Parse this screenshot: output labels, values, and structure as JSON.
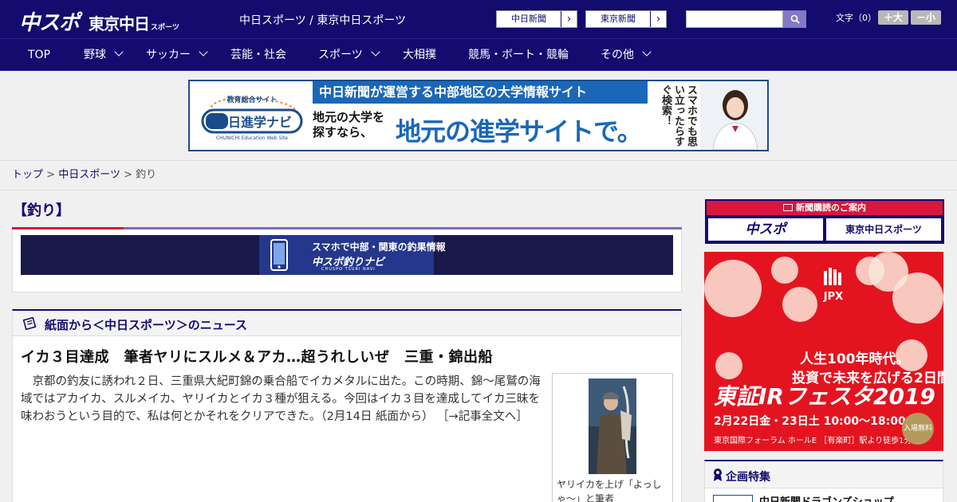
{
  "header": {
    "logo_main": "中スポ",
    "logo_sub": "東京中日",
    "logo_small": "スポーツ",
    "site_title": "中日スポーツ / 東京中日スポーツ",
    "links": [
      {
        "label": "中日新聞",
        "arrow": "›"
      },
      {
        "label": "東京新聞",
        "arrow": "›"
      }
    ],
    "search": {
      "placeholder": ""
    },
    "font_size": {
      "label": "文字（0）",
      "bigger": "＋大",
      "smaller": "－小"
    }
  },
  "nav": {
    "items": [
      {
        "label": "TOP",
        "has_menu": false
      },
      {
        "label": "野球",
        "has_menu": true
      },
      {
        "label": "サッカー",
        "has_menu": true
      },
      {
        "label": "芸能・社会",
        "has_menu": false
      },
      {
        "label": "スポーツ",
        "has_menu": true
      },
      {
        "label": "大相撲",
        "has_menu": false
      },
      {
        "label": "競馬・ボート・競輪",
        "has_menu": false
      },
      {
        "label": "その他",
        "has_menu": true
      }
    ]
  },
  "banner": {
    "logo_top": "教育総合サイト",
    "logo_main": "中日進学ナビ",
    "logo_sub": "CHUNICHI Education Web Site",
    "headline": "中日新聞が運営する中部地区の大学情報サイト",
    "sub": "地元の大学を探すなら、",
    "big": "地元の進学サイトで。",
    "vertical": "スマホでも思い立ったらすぐ検索！"
  },
  "breadcrumb": {
    "items": [
      "トップ",
      "中日スポーツ",
      "釣り"
    ],
    "separator": ">"
  },
  "category_title": "【釣り】",
  "promo": {
    "line1": "スマホで中部・関東の釣果情報",
    "line2": "中スポ釣りナビ",
    "line3": "CHUSPO TSURI NAVI"
  },
  "news": {
    "section_title": "紙面から＜中日スポーツ＞のニュース",
    "headline": "イカ３目達成　筆者ヤリにスルメ＆アカ…超うれしいぜ　三重・錦出船",
    "body": "　京都の釣友に誘われ２日、三重県大紀町錦の乗合船でイカメタルに出た。この時期、錦～尾鷲の海域ではアカイカ、スルメイカ、ヤリイカとイカ３種が狙える。今回はイカ３目を達成してイカ三昧を味わおうという目的で、私は何とかそれをクリアできた。（2月14日 紙面から）",
    "more_link": "［→記事全文へ］",
    "photo_caption": "ヤリイカを上げ「よっしゃ～」と筆者"
  },
  "sidebar": {
    "subscription_header": "新聞購読のご案内",
    "subscription_buttons": [
      "中スポ",
      "東京中日スポーツ"
    ],
    "ad": {
      "brand": "JPX",
      "line1": "人生100年時代。",
      "line2": "投資で未来を広げる2日間。",
      "title": "東証IRフェスタ2019",
      "date": "2月22日金・23日土 10:00～18:00",
      "venue": "東京国際フォーラム ホールE ［有楽町］駅より徒歩1分",
      "badge": "入場無料"
    },
    "feature_title": "企画特集",
    "feature_item": "中日新聞ドラゴンズショップ"
  },
  "colors": {
    "header_bg": "#130b6e",
    "accent_red": "#d9163b",
    "banner_blue": "#1a67b8",
    "ad_red": "#e3141f"
  }
}
